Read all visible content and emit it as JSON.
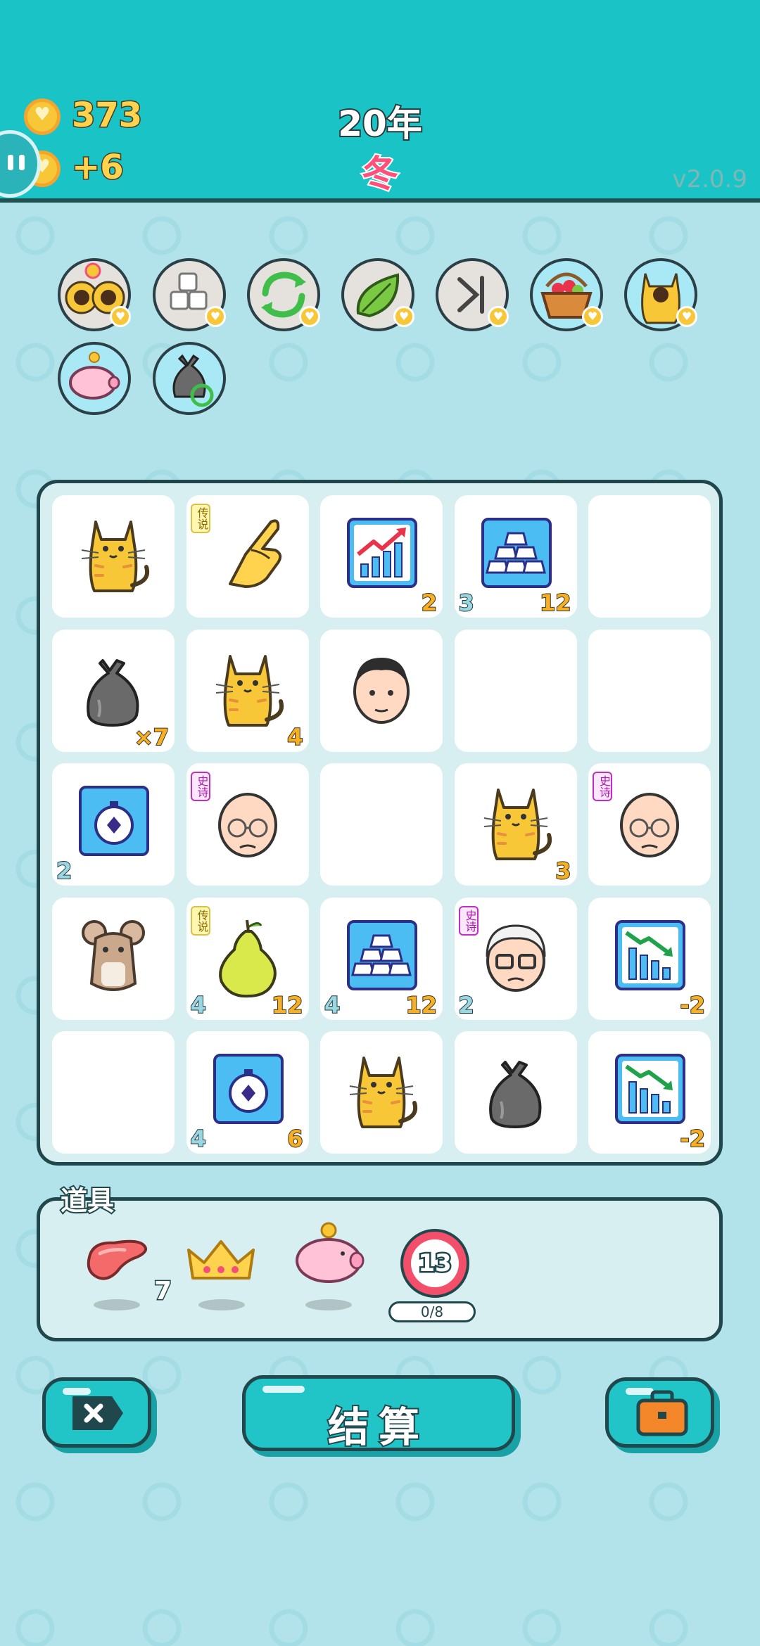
{
  "header": {
    "coins": "373",
    "income": "+6",
    "year": "20年",
    "season": "冬",
    "version": "v2.0.9"
  },
  "relics": [
    {
      "icon": "sunflower-cats-icon"
    },
    {
      "icon": "cubes-icon"
    },
    {
      "icon": "refresh-arrows-icon"
    },
    {
      "icon": "leaf-icon"
    },
    {
      "icon": "skip-end-icon"
    },
    {
      "icon": "fruit-basket-icon"
    },
    {
      "icon": "cat-icon"
    },
    {
      "icon": "piggy-bank-icon"
    },
    {
      "icon": "recycle-bag-icon"
    }
  ],
  "board": [
    [
      {
        "symbol": "cat"
      },
      {
        "symbol": "pointing-hand",
        "rarity": "传说"
      },
      {
        "symbol": "chart-up",
        "right": "2"
      },
      {
        "symbol": "gold-bars",
        "left": "3",
        "right": "12"
      },
      {
        "symbol": "empty"
      }
    ],
    [
      {
        "symbol": "garbage-bag",
        "right": "×7"
      },
      {
        "symbol": "cat",
        "right": "4"
      },
      {
        "symbol": "man-face"
      },
      {
        "symbol": "empty"
      },
      {
        "symbol": "empty"
      }
    ],
    [
      {
        "symbol": "stopwatch",
        "left": "2"
      },
      {
        "symbol": "old-man",
        "rarity": "史诗"
      },
      {
        "symbol": "empty"
      },
      {
        "symbol": "cat",
        "right": "3"
      },
      {
        "symbol": "old-man",
        "rarity": "史诗"
      }
    ],
    [
      {
        "symbol": "mouse"
      },
      {
        "symbol": "pear",
        "rarity": "传说",
        "left": "4",
        "right": "12"
      },
      {
        "symbol": "gold-bars",
        "left": "4",
        "right": "12"
      },
      {
        "symbol": "grandpa",
        "rarity": "史诗",
        "left": "2"
      },
      {
        "symbol": "chart-down",
        "right": "-2"
      }
    ],
    [
      {
        "symbol": "empty"
      },
      {
        "symbol": "stopwatch",
        "left": "4",
        "right": "6"
      },
      {
        "symbol": "cat"
      },
      {
        "symbol": "garbage-bag"
      },
      {
        "symbol": "chart-down",
        "right": "-2"
      }
    ]
  ],
  "items": {
    "title": "道具",
    "list": [
      {
        "icon": "liver-icon",
        "count": "7"
      },
      {
        "icon": "crown-icon"
      },
      {
        "icon": "piggy-bank-icon"
      },
      {
        "icon": "timer-badge-icon",
        "badge": "13",
        "progress": "0/8"
      }
    ]
  },
  "buttons": {
    "quit_icon": "close-tag-icon",
    "settle_label": "结算",
    "bag_icon": "briefcase-icon"
  },
  "colors": {
    "header": "#19c3c6",
    "background": "#b3e3ea",
    "coin": "#f7c737",
    "outline": "#20474c"
  }
}
